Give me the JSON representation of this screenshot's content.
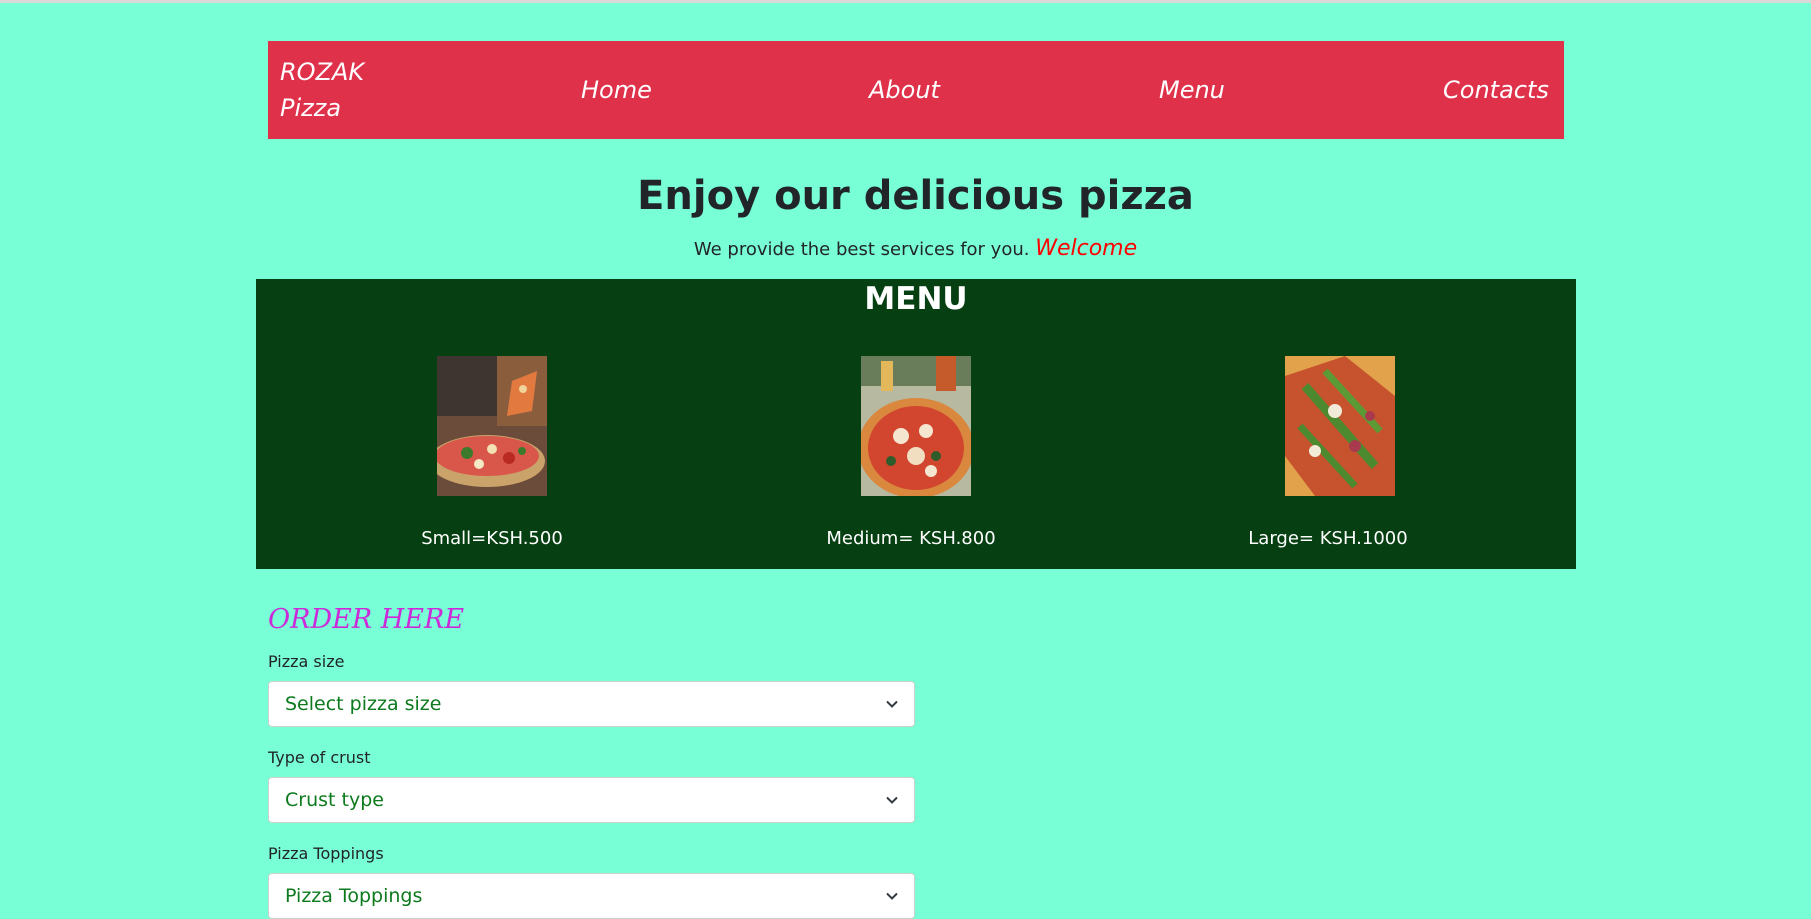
{
  "navbar": {
    "brand_line1": "ROZAK",
    "brand_line2": "Pizza",
    "links": [
      "Home",
      "About",
      "Menu",
      "Contacts"
    ]
  },
  "hero": {
    "title": "Enjoy our delicious pizza",
    "subtitle": "We provide the best services for you.",
    "welcome": "Welcome"
  },
  "menu": {
    "title": "MENU",
    "items": [
      {
        "price": "Small=KSH.500"
      },
      {
        "price": "Medium= KSH.800"
      },
      {
        "price": "Large= KSH.1000"
      }
    ]
  },
  "order": {
    "title": "ORDER HERE",
    "fields": [
      {
        "label": "Pizza size",
        "placeholder": "Select pizza size"
      },
      {
        "label": "Type of crust",
        "placeholder": "Crust type"
      },
      {
        "label": "Pizza Toppings",
        "placeholder": "Pizza Toppings"
      }
    ]
  },
  "colors": {
    "background": "#78ffd6",
    "navbar": "#e0314b",
    "menu_section": "#063f11",
    "order_title": "#cc2ad9",
    "welcome": "#ff0000",
    "select_text": "#0c7a1d"
  },
  "icons": [
    "chevron-down-icon"
  ]
}
